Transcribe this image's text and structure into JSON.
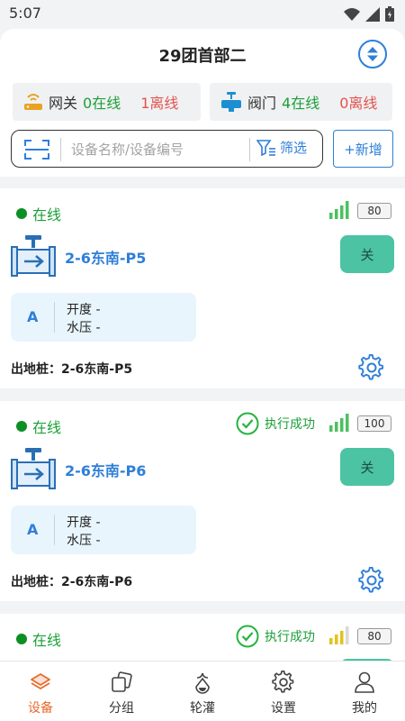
{
  "status_bar": {
    "time": "5:07"
  },
  "header": {
    "title": "29团首部二"
  },
  "gateway": {
    "label": "网关",
    "online": "0在线",
    "offline": "1离线"
  },
  "valve": {
    "label": "阀门",
    "online": "4在线",
    "offline": "0离线"
  },
  "search": {
    "placeholder": "设备名称/设备编号",
    "filter_label": "筛选",
    "add_label": "+新增"
  },
  "cards": [
    {
      "status": "在线",
      "exec": "",
      "battery": "80",
      "name": "2-6东南-P5",
      "button": "关",
      "letter": "A",
      "line1": "开度  -",
      "line2": "水压  -",
      "outlet": "出地桩：2-6东南-P5",
      "signal_color": "#4cc05f"
    },
    {
      "status": "在线",
      "exec": "执行成功",
      "battery": "100",
      "name": "2-6东南-P6",
      "button": "关",
      "letter": "A",
      "line1": "开度  -",
      "line2": "水压  -",
      "outlet": "出地桩：2-6东南-P6",
      "signal_color": "#4cc05f"
    },
    {
      "status": "在线",
      "exec": "执行成功",
      "battery": "80",
      "name": "",
      "button": "",
      "letter": "",
      "line1": "",
      "line2": "",
      "outlet": "",
      "signal_color": "#e3c21c"
    }
  ],
  "tabs": [
    {
      "label": "设备",
      "active": true,
      "icon": "layers-icon"
    },
    {
      "label": "分组",
      "active": false,
      "icon": "group-icon"
    },
    {
      "label": "轮灌",
      "active": false,
      "icon": "irrigation-icon"
    },
    {
      "label": "设置",
      "active": false,
      "icon": "settings-icon"
    },
    {
      "label": "我的",
      "active": false,
      "icon": "user-icon"
    }
  ],
  "colors": {
    "accent": "#2f7fd8",
    "online": "#1ba038",
    "offline": "#e4524e",
    "active_tab": "#e86a2d",
    "button": "#4cc3a3"
  }
}
